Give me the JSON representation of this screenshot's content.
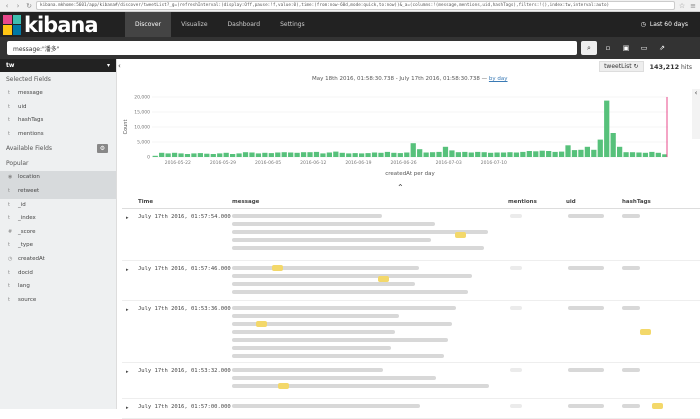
{
  "browser": {
    "url": "kibana.mkhome:5601/app/kibana#/discover/tweetList?_g=(refreshInterval:(display:Off,pause:!f,value:0),time:(from:now-60d,mode:quick,to:now))&_a=(columns:!(message,mentions,uid,hashTags),filters:!(),index:tw,interval:auto)"
  },
  "nav": {
    "logo": "kibana",
    "tabs": [
      "Discover",
      "Visualize",
      "Dashboard",
      "Settings"
    ],
    "time_label": "Last 60 days"
  },
  "search": {
    "query": "message:\"潘多\""
  },
  "sidebar": {
    "index": "tw",
    "selected_header": "Selected Fields",
    "selected": [
      "message",
      "uid",
      "hashTags",
      "mentions"
    ],
    "available_header": "Available Fields",
    "popular_header": "Popular",
    "popular": [
      "location",
      "retweet"
    ],
    "available": [
      "_id",
      "_index",
      "_score",
      "_type",
      "createdAt",
      "docid",
      "lang",
      "source"
    ]
  },
  "hits": {
    "saved": "tweetList",
    "count": "143,212",
    "suffix": "hits"
  },
  "range": {
    "text": "May 18th 2016, 01:58:30.738 - July 17th 2016, 01:58:30.738 — ",
    "by": "by day"
  },
  "colors": {
    "bar": "#57c17b",
    "accent": "#e8488b",
    "nav": "#222222"
  },
  "chart_data": {
    "type": "bar",
    "ylabel": "Count",
    "xlabel": "createdAt per day",
    "ylim": [
      0,
      20000
    ],
    "yticks": [
      "20,000",
      "15,000",
      "10,000",
      "5,000",
      "0"
    ],
    "xticks": [
      "2016-05-22",
      "2016-05-29",
      "2016-06-05",
      "2016-06-12",
      "2016-06-19",
      "2016-06-26",
      "2016-07-03",
      "2016-07-10"
    ],
    "values": [
      400,
      1400,
      1200,
      1400,
      1200,
      1000,
      1200,
      1300,
      1100,
      1000,
      1200,
      1400,
      1000,
      1200,
      1600,
      1500,
      1200,
      1400,
      1300,
      1500,
      1600,
      1500,
      1400,
      1600,
      1600,
      1700,
      1200,
      1500,
      1800,
      1400,
      1200,
      1300,
      1200,
      1300,
      1500,
      1400,
      1700,
      1400,
      1300,
      1500,
      4600,
      2600,
      1500,
      1600,
      1700,
      3400,
      2200,
      1600,
      1700,
      1500,
      1700,
      1600,
      1400,
      1500,
      1500,
      1600,
      1500,
      1700,
      2000,
      1900,
      2100,
      2000,
      1700,
      1800,
      3900,
      2300,
      2400,
      3400,
      2400,
      5800,
      18800,
      8000,
      3400,
      1600,
      1600,
      1500,
      1400,
      1700,
      1400,
      900
    ]
  },
  "table": {
    "headers": [
      "Time",
      "message",
      "mentions",
      "uid",
      "hashTags"
    ],
    "rows": [
      {
        "time": "July 17th 2016, 01:57:54.000"
      },
      {
        "time": "July 17th 2016, 01:57:46.000"
      },
      {
        "time": "July 17th 2016, 01:53:36.000"
      },
      {
        "time": "July 17th 2016, 01:53:32.000"
      },
      {
        "time": "July 17th 2016, 01:57:00.000"
      }
    ]
  }
}
